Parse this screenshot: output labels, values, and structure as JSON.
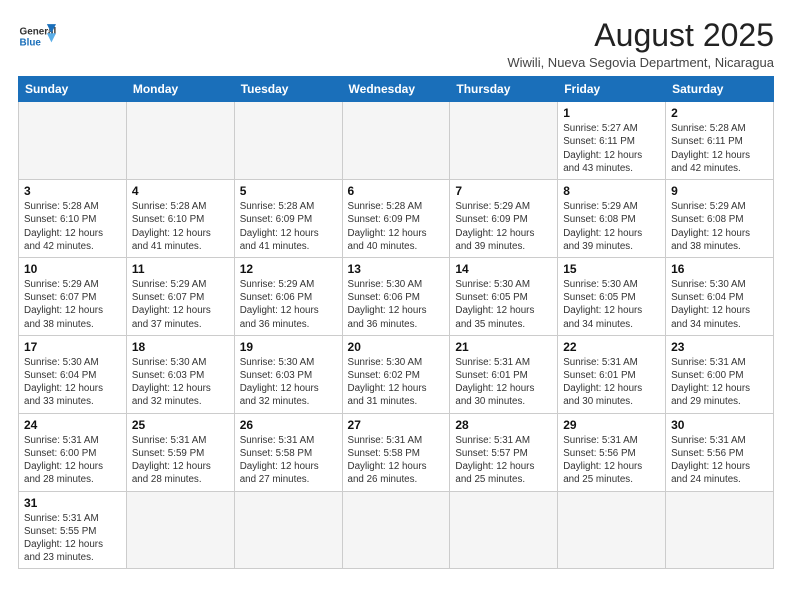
{
  "header": {
    "logo_general": "General",
    "logo_blue": "Blue",
    "month_title": "August 2025",
    "location": "Wiwili, Nueva Segovia Department, Nicaragua"
  },
  "days_of_week": [
    "Sunday",
    "Monday",
    "Tuesday",
    "Wednesday",
    "Thursday",
    "Friday",
    "Saturday"
  ],
  "weeks": [
    [
      {
        "day": "",
        "info": ""
      },
      {
        "day": "",
        "info": ""
      },
      {
        "day": "",
        "info": ""
      },
      {
        "day": "",
        "info": ""
      },
      {
        "day": "",
        "info": ""
      },
      {
        "day": "1",
        "info": "Sunrise: 5:27 AM\nSunset: 6:11 PM\nDaylight: 12 hours and 43 minutes."
      },
      {
        "day": "2",
        "info": "Sunrise: 5:28 AM\nSunset: 6:11 PM\nDaylight: 12 hours and 42 minutes."
      }
    ],
    [
      {
        "day": "3",
        "info": "Sunrise: 5:28 AM\nSunset: 6:10 PM\nDaylight: 12 hours and 42 minutes."
      },
      {
        "day": "4",
        "info": "Sunrise: 5:28 AM\nSunset: 6:10 PM\nDaylight: 12 hours and 41 minutes."
      },
      {
        "day": "5",
        "info": "Sunrise: 5:28 AM\nSunset: 6:09 PM\nDaylight: 12 hours and 41 minutes."
      },
      {
        "day": "6",
        "info": "Sunrise: 5:28 AM\nSunset: 6:09 PM\nDaylight: 12 hours and 40 minutes."
      },
      {
        "day": "7",
        "info": "Sunrise: 5:29 AM\nSunset: 6:09 PM\nDaylight: 12 hours and 39 minutes."
      },
      {
        "day": "8",
        "info": "Sunrise: 5:29 AM\nSunset: 6:08 PM\nDaylight: 12 hours and 39 minutes."
      },
      {
        "day": "9",
        "info": "Sunrise: 5:29 AM\nSunset: 6:08 PM\nDaylight: 12 hours and 38 minutes."
      }
    ],
    [
      {
        "day": "10",
        "info": "Sunrise: 5:29 AM\nSunset: 6:07 PM\nDaylight: 12 hours and 38 minutes."
      },
      {
        "day": "11",
        "info": "Sunrise: 5:29 AM\nSunset: 6:07 PM\nDaylight: 12 hours and 37 minutes."
      },
      {
        "day": "12",
        "info": "Sunrise: 5:29 AM\nSunset: 6:06 PM\nDaylight: 12 hours and 36 minutes."
      },
      {
        "day": "13",
        "info": "Sunrise: 5:30 AM\nSunset: 6:06 PM\nDaylight: 12 hours and 36 minutes."
      },
      {
        "day": "14",
        "info": "Sunrise: 5:30 AM\nSunset: 6:05 PM\nDaylight: 12 hours and 35 minutes."
      },
      {
        "day": "15",
        "info": "Sunrise: 5:30 AM\nSunset: 6:05 PM\nDaylight: 12 hours and 34 minutes."
      },
      {
        "day": "16",
        "info": "Sunrise: 5:30 AM\nSunset: 6:04 PM\nDaylight: 12 hours and 34 minutes."
      }
    ],
    [
      {
        "day": "17",
        "info": "Sunrise: 5:30 AM\nSunset: 6:04 PM\nDaylight: 12 hours and 33 minutes."
      },
      {
        "day": "18",
        "info": "Sunrise: 5:30 AM\nSunset: 6:03 PM\nDaylight: 12 hours and 32 minutes."
      },
      {
        "day": "19",
        "info": "Sunrise: 5:30 AM\nSunset: 6:03 PM\nDaylight: 12 hours and 32 minutes."
      },
      {
        "day": "20",
        "info": "Sunrise: 5:30 AM\nSunset: 6:02 PM\nDaylight: 12 hours and 31 minutes."
      },
      {
        "day": "21",
        "info": "Sunrise: 5:31 AM\nSunset: 6:01 PM\nDaylight: 12 hours and 30 minutes."
      },
      {
        "day": "22",
        "info": "Sunrise: 5:31 AM\nSunset: 6:01 PM\nDaylight: 12 hours and 30 minutes."
      },
      {
        "day": "23",
        "info": "Sunrise: 5:31 AM\nSunset: 6:00 PM\nDaylight: 12 hours and 29 minutes."
      }
    ],
    [
      {
        "day": "24",
        "info": "Sunrise: 5:31 AM\nSunset: 6:00 PM\nDaylight: 12 hours and 28 minutes."
      },
      {
        "day": "25",
        "info": "Sunrise: 5:31 AM\nSunset: 5:59 PM\nDaylight: 12 hours and 28 minutes."
      },
      {
        "day": "26",
        "info": "Sunrise: 5:31 AM\nSunset: 5:58 PM\nDaylight: 12 hours and 27 minutes."
      },
      {
        "day": "27",
        "info": "Sunrise: 5:31 AM\nSunset: 5:58 PM\nDaylight: 12 hours and 26 minutes."
      },
      {
        "day": "28",
        "info": "Sunrise: 5:31 AM\nSunset: 5:57 PM\nDaylight: 12 hours and 25 minutes."
      },
      {
        "day": "29",
        "info": "Sunrise: 5:31 AM\nSunset: 5:56 PM\nDaylight: 12 hours and 25 minutes."
      },
      {
        "day": "30",
        "info": "Sunrise: 5:31 AM\nSunset: 5:56 PM\nDaylight: 12 hours and 24 minutes."
      }
    ],
    [
      {
        "day": "31",
        "info": "Sunrise: 5:31 AM\nSunset: 5:55 PM\nDaylight: 12 hours and 23 minutes."
      },
      {
        "day": "",
        "info": ""
      },
      {
        "day": "",
        "info": ""
      },
      {
        "day": "",
        "info": ""
      },
      {
        "day": "",
        "info": ""
      },
      {
        "day": "",
        "info": ""
      },
      {
        "day": "",
        "info": ""
      }
    ]
  ]
}
